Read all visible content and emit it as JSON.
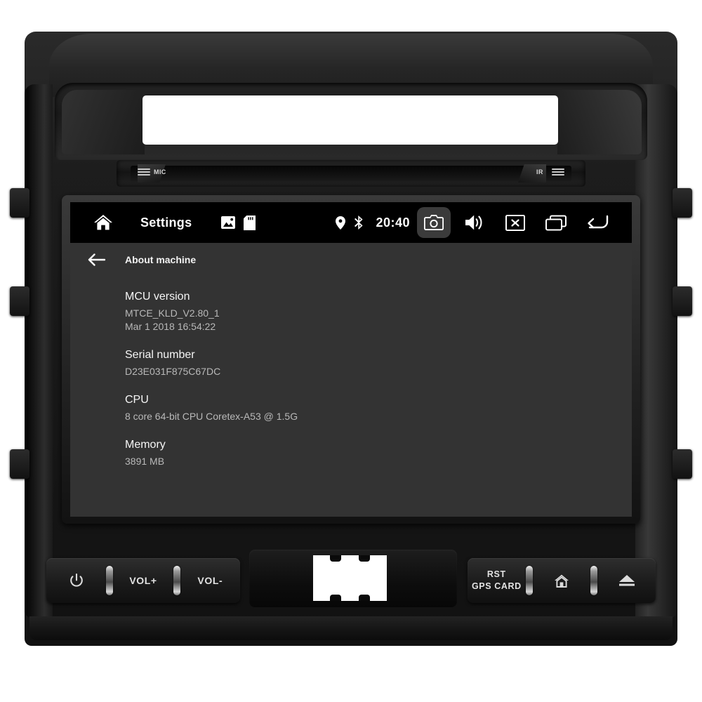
{
  "device": {
    "name": "android-car-head-unit",
    "mic_label": "MIC",
    "ir_label": "IR"
  },
  "screen": {
    "statusbar": {
      "home_icon": "home-icon",
      "title": "Settings",
      "gallery_icon": "gallery-icon",
      "sdcard_icon": "sd-card-icon",
      "location_icon": "location-pin-icon",
      "bluetooth_icon": "bluetooth-icon",
      "clock": "20:40",
      "buttons": [
        {
          "icon": "camera-icon",
          "active": true
        },
        {
          "icon": "volume-icon",
          "active": false
        },
        {
          "icon": "close-icon",
          "active": false
        },
        {
          "icon": "recents-icon",
          "active": false
        },
        {
          "icon": "back-arrow-icon",
          "active": false
        }
      ]
    },
    "subheader": {
      "back_icon": "arrow-left-icon",
      "title": "About machine"
    },
    "about_items": [
      {
        "title": "MCU version",
        "value": "MTCE_KLD_V2.80_1",
        "value2": "Mar  1 2018 16:54:22"
      },
      {
        "title": "Serial number",
        "value": "D23E031F875C67DC",
        "value2": ""
      },
      {
        "title": "CPU",
        "value": "8 core 64-bit CPU Coretex-A53 @ 1.5G",
        "value2": ""
      },
      {
        "title": "Memory",
        "value": "3891 MB",
        "value2": ""
      }
    ]
  },
  "hardware_buttons": {
    "left": [
      {
        "label": "",
        "icon": "power-icon"
      },
      {
        "label": "VOL+",
        "icon": ""
      },
      {
        "label": "VOL-",
        "icon": ""
      }
    ],
    "right": [
      {
        "label": "RST",
        "label2": "GPS CARD",
        "icon": ""
      },
      {
        "label": "",
        "icon": "home-icon"
      },
      {
        "label": "",
        "icon": "eject-icon"
      }
    ]
  },
  "colors": {
    "statusbar_bg": "#000000",
    "screen_bg": "#333333",
    "text_primary": "#f5f5f5",
    "text_secondary": "#b9b9b9",
    "active_highlight": "#3b3b3b",
    "bezel": "#1b1b1b"
  }
}
